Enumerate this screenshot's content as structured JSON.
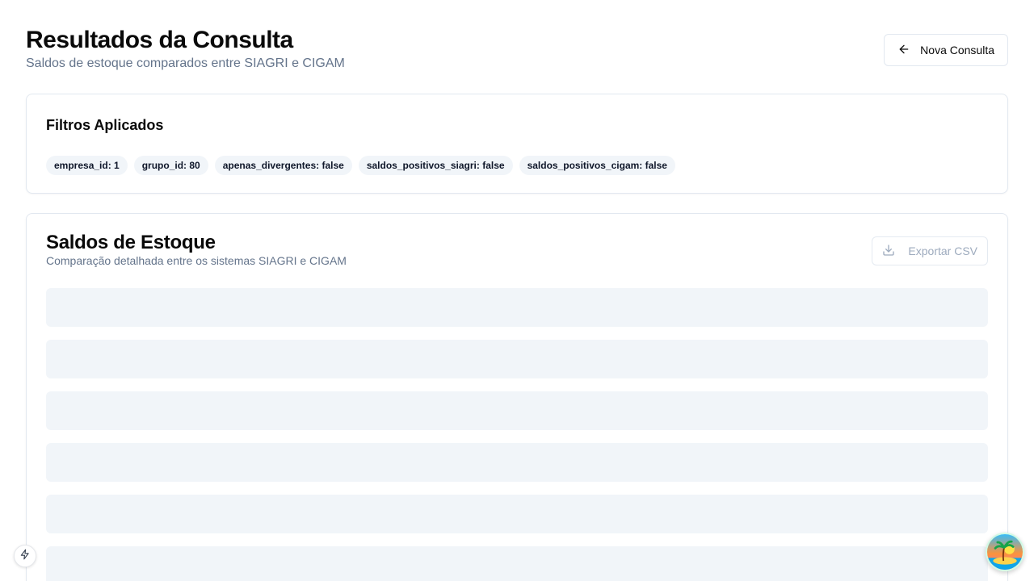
{
  "header": {
    "title": "Resultados da Consulta",
    "subtitle": "Saldos de estoque comparados entre SIAGRI e CIGAM",
    "new_query_label": "Nova Consulta"
  },
  "filters": {
    "title": "Filtros Aplicados",
    "badges": [
      "empresa_id: 1",
      "grupo_id: 80",
      "apenas_divergentes: false",
      "saldos_positivos_siagri: false",
      "saldos_positivos_cigam: false"
    ]
  },
  "stock": {
    "title": "Saldos de Estoque",
    "description": "Comparação detalhada entre os sistemas SIAGRI e CIGAM",
    "export_label": "Exportar CSV",
    "loading": true
  },
  "colors": {
    "skeleton": "#f1f5f9",
    "muted_text": "#64748b",
    "border": "#e2e8f0"
  }
}
